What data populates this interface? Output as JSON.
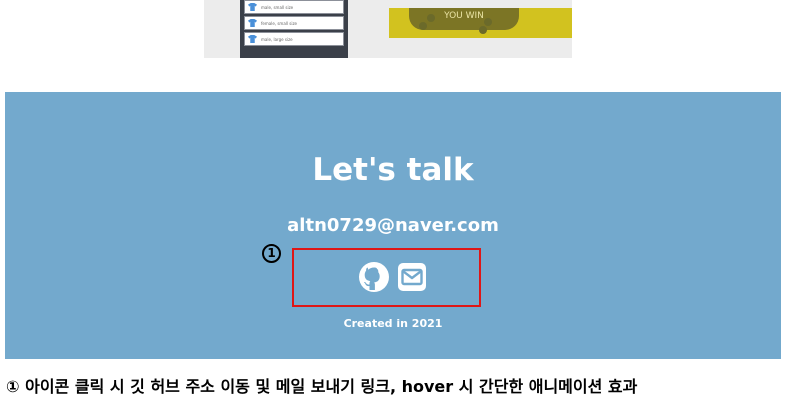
{
  "preview": {
    "list_items": [
      {
        "label": "male, small size"
      },
      {
        "label": "female, small size"
      },
      {
        "label": "male, large size"
      }
    ],
    "banner_text": "YOU WIN"
  },
  "contact": {
    "title": "Let's talk",
    "email": "altn0729@naver.com",
    "icons": [
      {
        "name": "github-icon"
      },
      {
        "name": "envelope-icon"
      }
    ],
    "footer": "Created in 2021",
    "background_color": "#73a9cd",
    "highlight_color": "#e01616"
  },
  "annotation": {
    "marker": "1",
    "caption": "① 아이콘 클릭 시 깃 허브 주소 이동 및 메일 보내기 링크, hover 시 간단한 애니메이션 효과"
  }
}
